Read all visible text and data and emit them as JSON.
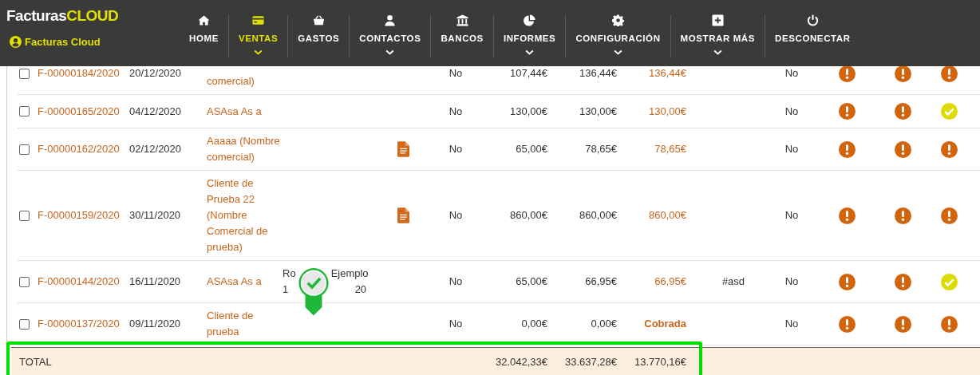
{
  "brand": {
    "name": "Facturas",
    "accent": "CLOUD",
    "user": "Facturas Cloud"
  },
  "nav": [
    {
      "label": "HOME",
      "kind": "home",
      "selected": false,
      "dropdown": false
    },
    {
      "label": "VENTAS",
      "kind": "card",
      "selected": true,
      "dropdown": true
    },
    {
      "label": "GASTOS",
      "kind": "basket",
      "selected": false,
      "dropdown": false
    },
    {
      "label": "CONTACTOS",
      "kind": "user",
      "selected": false,
      "dropdown": true
    },
    {
      "label": "BANCOS",
      "kind": "bank",
      "selected": false,
      "dropdown": false
    },
    {
      "label": "INFORMES",
      "kind": "pie",
      "selected": false,
      "dropdown": true
    },
    {
      "label": "CONFIGURACIÓN",
      "kind": "gear",
      "selected": false,
      "dropdown": true
    },
    {
      "label": "MOSTRAR MÁS",
      "kind": "plus",
      "selected": false,
      "dropdown": true
    },
    {
      "label": "DESCONECTAR",
      "kind": "power",
      "selected": false,
      "dropdown": false
    }
  ],
  "rows": [
    {
      "checked": false,
      "number": "F-00000184/2020",
      "date": "20/12/2020",
      "client": "comercial)",
      "attachment": false,
      "column_7": "No",
      "base": "107,44€",
      "total": "136,44€",
      "pending": "136,44€",
      "paid": false,
      "column_12": "No",
      "status": [
        {
          "done": false
        },
        {
          "done": false
        },
        {
          "done": false
        }
      ]
    },
    {
      "checked": false,
      "number": "F-00000165/2020",
      "date": "04/12/2020",
      "client": "ASAsa As a",
      "attachment": false,
      "column_7": "No",
      "base": "130,00€",
      "total": "130,00€",
      "pending": "130,00€",
      "paid": false,
      "column_12": "No",
      "status": [
        {
          "done": false
        },
        {
          "done": false
        },
        {
          "done": true
        }
      ]
    },
    {
      "checked": false,
      "number": "F-00000162/2020",
      "date": "02/12/2020",
      "client": "Aaaaa (Nombre comercial)",
      "attachment": true,
      "column_7": "No",
      "base": "65,00€",
      "total": "78,65€",
      "pending": "78,65€",
      "paid": false,
      "column_12": "No",
      "status": [
        {
          "done": false
        },
        {
          "done": false
        },
        {
          "done": false
        }
      ]
    },
    {
      "checked": false,
      "number": "F-00000159/2020",
      "date": "30/11/2020",
      "client": "Cliente de Prueba 22 (Nombre Comercial de prueba)",
      "attachment": true,
      "column_7": "No",
      "base": "860,00€",
      "total": "860,00€",
      "pending": "860,00€",
      "paid": false,
      "column_12": "No",
      "status": [
        {
          "done": false
        },
        {
          "done": false
        },
        {
          "done": false
        }
      ]
    },
    {
      "checked": false,
      "number": "F-00000144/2020",
      "date": "16/11/2020",
      "client": "ASAsa As a",
      "concept": [
        "Ro",
        "Ejemplo",
        "1",
        "20"
      ],
      "attachment": false,
      "column_7": "No",
      "base": "65,00€",
      "total": "66,95€",
      "pending": "66,95€",
      "paid": false,
      "tag": "#asd",
      "column_12": "No",
      "status": [
        {
          "done": false
        },
        {
          "done": false
        },
        {
          "done": true
        }
      ]
    },
    {
      "checked": false,
      "number": "F-00000137/2020",
      "date": "09/11/2020",
      "client": "Cliente de prueba",
      "attachment": false,
      "column_7": "No",
      "base": "0,00€",
      "total": "0,00€",
      "pending": "Cobrada",
      "paid": true,
      "column_12": "No",
      "status": [
        {
          "done": false
        },
        {
          "done": false
        },
        {
          "done": false
        }
      ]
    }
  ],
  "totals": {
    "label": "TOTAL",
    "base": "32.042,33€",
    "total": "33.637,28€",
    "pending": "13.770,16€"
  }
}
